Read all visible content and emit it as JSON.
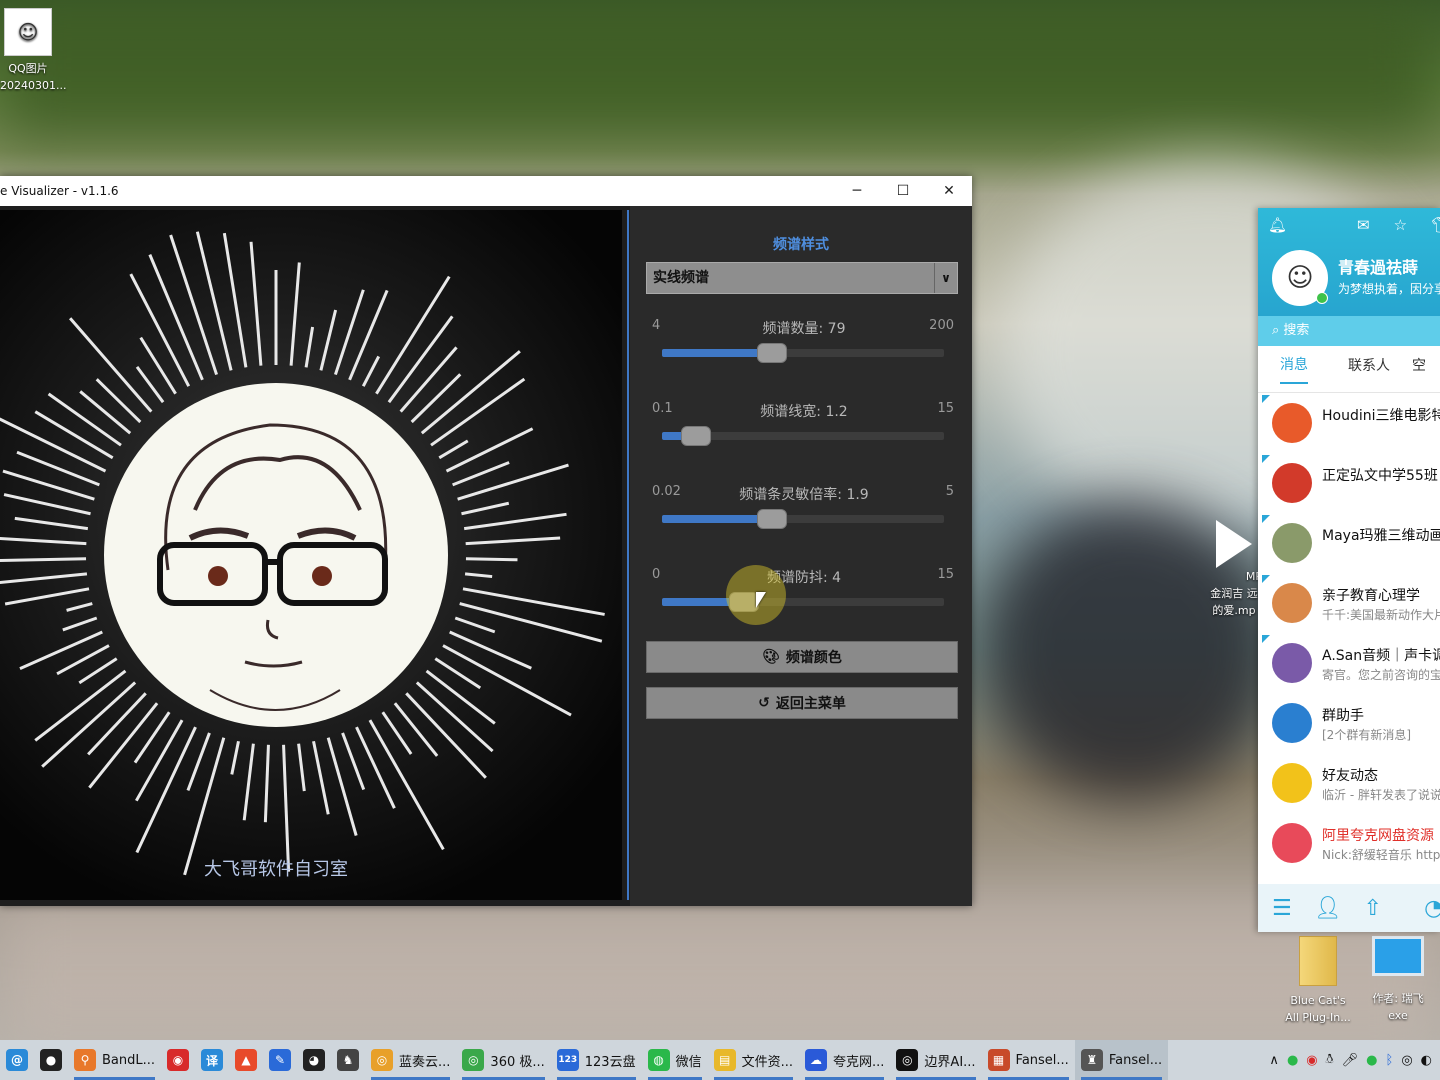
{
  "desktop": {
    "icons": [
      {
        "label_line1": "QQ图片",
        "label_line2": "20240301..."
      },
      {
        "label_line1": "Blue Cat's",
        "label_line2": "All Plug-In..."
      },
      {
        "label_line1": "作者: 瑞飞",
        "label_line2": "exe"
      },
      {
        "label_line1": "MP",
        "label_line2": "金润吉 远"
      },
      {
        "label_line3": "的爱.mp"
      }
    ]
  },
  "window": {
    "title": "e Visualizer - v1.1.6",
    "minimize": "─",
    "maximize": "☐",
    "close": "✕",
    "canvas_caption": "大飞哥软件自习室",
    "bar_color": "#e8e8e8"
  },
  "panel": {
    "section_title": "频谱样式",
    "style_select": {
      "value": "实线频谱",
      "arrow": "∨"
    },
    "sliders": [
      {
        "min": "4",
        "max": "200",
        "label": "频谱数量: 79",
        "fraction": 0.39
      },
      {
        "min": "0.1",
        "max": "15",
        "label": "频谱线宽: 1.2",
        "fraction": 0.12
      },
      {
        "min": "0.02",
        "max": "5",
        "label": "频谱条灵敏倍率: 1.9",
        "fraction": 0.39
      },
      {
        "min": "0",
        "max": "15",
        "label": "频谱防抖: 4",
        "fraction": 0.29
      }
    ],
    "color_button": {
      "label": "频谱颜色",
      "icon": "palette-icon"
    },
    "back_button": {
      "label": "返回主菜单",
      "icon": "undo-icon"
    }
  },
  "qq": {
    "nickname": "青春過祛蒔",
    "signature": "为梦想执着，因分享",
    "search_placeholder": "搜索",
    "tabs": [
      "消息",
      "联系人",
      "空"
    ],
    "items": [
      {
        "name": "Houdini三维电影特",
        "sub": "",
        "color": "#e85a2a"
      },
      {
        "name": "正定弘文中学55班",
        "sub": "",
        "color": "#d23a2a"
      },
      {
        "name": "Maya玛雅三维动画",
        "sub": "",
        "color": "#8a9a6a"
      },
      {
        "name": "亲子教育心理学",
        "sub": "千千:美国最新动作大片",
        "color": "#d9884a"
      },
      {
        "name": "A.San音频｜声卡调",
        "sub": "寄官。您之前咨询的宝",
        "color": "#7a5aa8"
      },
      {
        "name": "群助手",
        "sub": "[2个群有新消息]",
        "color": "#2a7fd0"
      },
      {
        "name": "好友动态",
        "sub": "临沂 - 胖轩发表了说说",
        "color": "#f2c21a"
      },
      {
        "name": "阿里夸克网盘资源",
        "sub": "Nick:舒缓轻音乐 https",
        "color": "#e84a5a"
      }
    ]
  },
  "taskbar": {
    "items": [
      {
        "label": "",
        "icon": "at-icon",
        "color": "#2a8ad8"
      },
      {
        "label": "",
        "icon": "record-icon",
        "color": "#222"
      },
      {
        "label": "BandL...",
        "icon": "bandicam-icon",
        "color": "#e8782a"
      },
      {
        "label": "",
        "icon": "camera-icon",
        "color": "#d82a2a"
      },
      {
        "label": "",
        "icon": "translate-icon",
        "color": "#2a8ad8"
      },
      {
        "label": "",
        "icon": "shape-icon",
        "color": "#e84a2a"
      },
      {
        "label": "",
        "icon": "feather-icon",
        "color": "#2a6ad8"
      },
      {
        "label": "",
        "icon": "panda-icon",
        "color": "#222"
      },
      {
        "label": "",
        "icon": "fox-icon",
        "color": "#444"
      },
      {
        "label": "蓝奏云...",
        "icon": "chrome-icon",
        "color": "#e8a02a"
      },
      {
        "label": "360 极...",
        "icon": "browser360-icon",
        "color": "#3aa84a"
      },
      {
        "label": "123云盘",
        "icon": "cloud123-icon",
        "color": "#2a6ad8"
      },
      {
        "label": "微信",
        "icon": "wechat-icon",
        "color": "#2ab84a"
      },
      {
        "label": "文件资...",
        "icon": "folder-icon",
        "color": "#e8b82a"
      },
      {
        "label": "夸克网...",
        "icon": "quark-icon",
        "color": "#2a5ad8"
      },
      {
        "label": "边界AI...",
        "icon": "ai-icon",
        "color": "#111"
      },
      {
        "label": "Fansel...",
        "icon": "fansel-icon",
        "color": "#c84a2a"
      },
      {
        "label": "Fansel...",
        "icon": "fansel2-icon",
        "color": "#555"
      }
    ]
  }
}
